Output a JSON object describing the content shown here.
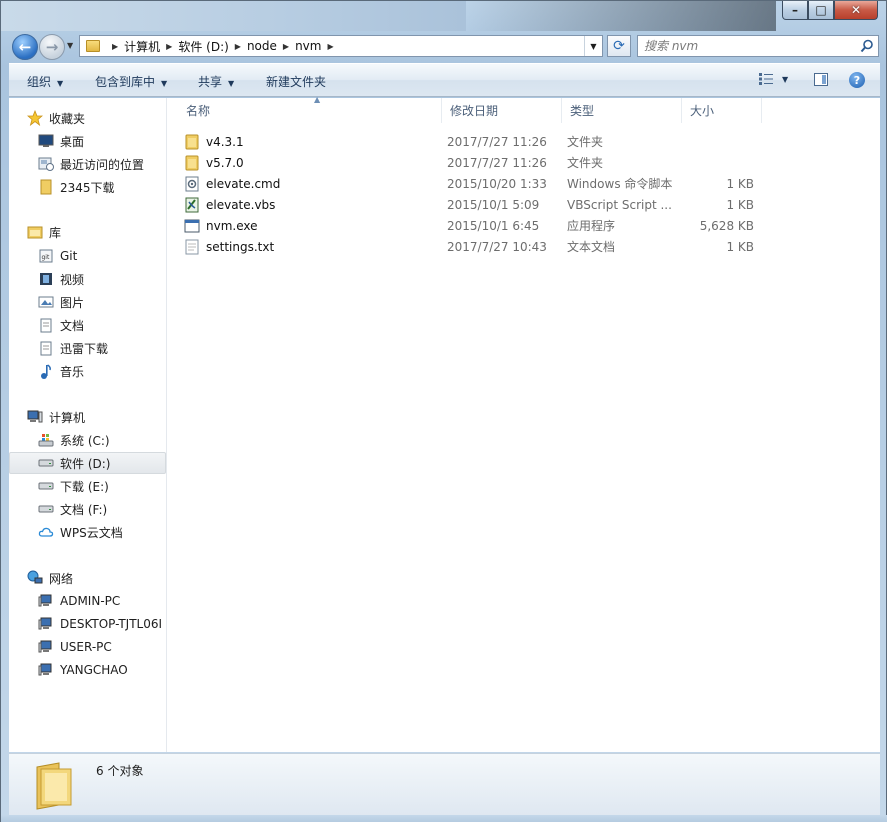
{
  "window": {
    "caption": {
      "minimize_glyph": "–",
      "maximize_glyph": "□",
      "close_glyph": "✕"
    }
  },
  "nav": {
    "back_glyph": "←",
    "forward_glyph": "→",
    "breadcrumbs": [
      "计算机",
      "软件 (D:)",
      "node",
      "nvm"
    ],
    "refresh_glyph": "⟳",
    "search_placeholder": "搜索 nvm"
  },
  "toolbar": {
    "organize": "组织",
    "include_in_library": "包含到库中",
    "share": "共享",
    "new_folder": "新建文件夹"
  },
  "sidebar": {
    "favorites": {
      "label": "收藏夹",
      "items": [
        {
          "label": "桌面",
          "icon": "desktop-icon"
        },
        {
          "label": "最近访问的位置",
          "icon": "recent-places-icon"
        },
        {
          "label": "2345下载",
          "icon": "folder-icon"
        }
      ]
    },
    "libraries": {
      "label": "库",
      "items": [
        {
          "label": "Git",
          "icon": "git-library-icon"
        },
        {
          "label": "视频",
          "icon": "video-icon"
        },
        {
          "label": "图片",
          "icon": "picture-icon"
        },
        {
          "label": "文档",
          "icon": "document-icon"
        },
        {
          "label": "迅雷下载",
          "icon": "document-icon"
        },
        {
          "label": "音乐",
          "icon": "music-icon"
        }
      ]
    },
    "computer": {
      "label": "计算机",
      "items": [
        {
          "label": "系统 (C:)",
          "icon": "system-drive-icon"
        },
        {
          "label": "软件 (D:)",
          "icon": "drive-icon",
          "selected": true
        },
        {
          "label": "下载 (E:)",
          "icon": "drive-icon"
        },
        {
          "label": "文档 (F:)",
          "icon": "drive-icon"
        },
        {
          "label": "WPS云文档",
          "icon": "cloud-icon"
        }
      ]
    },
    "network": {
      "label": "网络",
      "items": [
        {
          "label": "ADMIN-PC",
          "icon": "network-computer-icon"
        },
        {
          "label": "DESKTOP-TJTL06I",
          "icon": "network-computer-icon"
        },
        {
          "label": "USER-PC",
          "icon": "network-computer-icon"
        },
        {
          "label": "YANGCHAO",
          "icon": "network-computer-icon"
        }
      ]
    }
  },
  "filelist": {
    "columns": [
      "名称",
      "修改日期",
      "类型",
      "大小"
    ],
    "rows": [
      {
        "name": "v4.3.1",
        "date": "2017/7/27 11:26",
        "type": "文件夹",
        "size": "",
        "icon": "folder-icon"
      },
      {
        "name": "v5.7.0",
        "date": "2017/7/27 11:26",
        "type": "文件夹",
        "size": "",
        "icon": "folder-icon"
      },
      {
        "name": "elevate.cmd",
        "date": "2015/10/20 1:33",
        "type": "Windows 命令脚本",
        "size": "1 KB",
        "icon": "cmd-script-icon"
      },
      {
        "name": "elevate.vbs",
        "date": "2015/10/1 5:09",
        "type": "VBScript Script ...",
        "size": "1 KB",
        "icon": "vbs-script-icon"
      },
      {
        "name": "nvm.exe",
        "date": "2015/10/1 6:45",
        "type": "应用程序",
        "size": "5,628 KB",
        "icon": "application-icon"
      },
      {
        "name": "settings.txt",
        "date": "2017/7/27 10:43",
        "type": "文本文档",
        "size": "1 KB",
        "icon": "text-file-icon"
      }
    ]
  },
  "details": {
    "status": "6 个对象"
  },
  "colors": {
    "accent": "#2b6fc2",
    "folder": "#e8c35a",
    "header_text": "#4c607a"
  }
}
